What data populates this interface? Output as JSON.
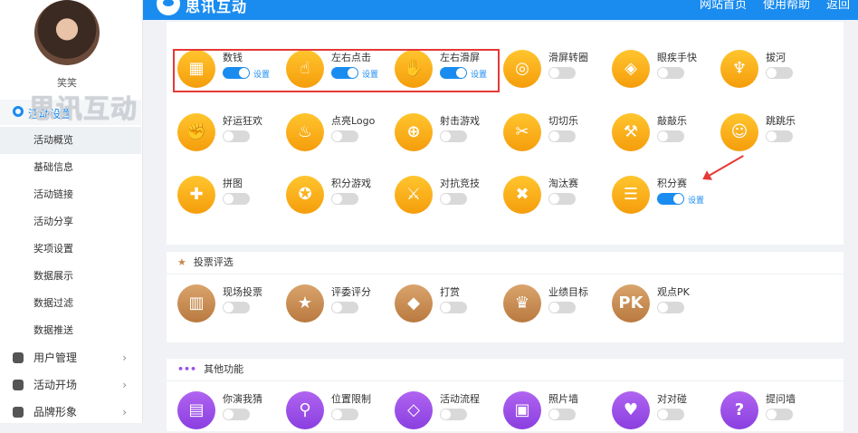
{
  "topbar": {
    "title": "思讯互动",
    "nav": [
      "网站首页",
      "使用帮助",
      "返回"
    ]
  },
  "sidebar": {
    "username": "笑笑",
    "watermark": "思讯互动",
    "active_label": "活动设置",
    "submenu": [
      "活动概览",
      "基础信息",
      "活动链接",
      "活动分享",
      "奖项设置",
      "数据展示",
      "数据过滤",
      "数据推送"
    ],
    "menu": [
      {
        "label": "用户管理",
        "icon": "user-icon"
      },
      {
        "label": "活动开场",
        "icon": "send-icon"
      },
      {
        "label": "品牌形象",
        "icon": "registered-icon"
      }
    ]
  },
  "setting_label": "设置",
  "games_section": {
    "rows": [
      [
        {
          "name": "数钱",
          "glyph": "▦",
          "on": true
        },
        {
          "name": "左右点击",
          "glyph": "☝",
          "on": true
        },
        {
          "name": "左右滑屏",
          "glyph": "✋",
          "on": true
        },
        {
          "name": "滑屏转圈",
          "glyph": "◎",
          "on": false
        },
        {
          "name": "眼疾手快",
          "glyph": "◈",
          "on": false
        },
        {
          "name": "拔河",
          "glyph": "♆",
          "on": false
        }
      ],
      [
        {
          "name": "好运狂欢",
          "glyph": "✊",
          "on": false
        },
        {
          "name": "点亮Logo",
          "glyph": "♨",
          "on": false
        },
        {
          "name": "射击游戏",
          "glyph": "⊕",
          "on": false
        },
        {
          "name": "切切乐",
          "glyph": "✂",
          "on": false
        },
        {
          "name": "敲敲乐",
          "glyph": "⚒",
          "on": false
        },
        {
          "name": "跳跳乐",
          "glyph": "☺",
          "on": false
        }
      ],
      [
        {
          "name": "拼图",
          "glyph": "✚",
          "on": false
        },
        {
          "name": "积分游戏",
          "glyph": "✪",
          "on": false
        },
        {
          "name": "对抗竞技",
          "glyph": "⚔",
          "on": false
        },
        {
          "name": "淘汰赛",
          "glyph": "✖",
          "on": false
        },
        {
          "name": "积分赛",
          "glyph": "☰",
          "on": true
        }
      ]
    ]
  },
  "vote_section": {
    "title": "投票评选",
    "items": [
      {
        "name": "现场投票",
        "glyph": "▥",
        "on": false
      },
      {
        "name": "评委评分",
        "glyph": "★",
        "on": false
      },
      {
        "name": "打赏",
        "glyph": "◆",
        "on": false
      },
      {
        "name": "业绩目标",
        "glyph": "♛",
        "on": false
      },
      {
        "name": "观点PK",
        "glyph": "PK",
        "on": false
      }
    ]
  },
  "other_section": {
    "title": "其他功能",
    "items": [
      {
        "name": "你演我猜",
        "glyph": "▤",
        "on": false
      },
      {
        "name": "位置限制",
        "glyph": "⚲",
        "on": false
      },
      {
        "name": "活动流程",
        "glyph": "◇",
        "on": false
      },
      {
        "name": "照片墙",
        "glyph": "▣",
        "on": false
      },
      {
        "name": "对对碰",
        "glyph": "♥",
        "on": false
      },
      {
        "name": "提问墙",
        "glyph": "?",
        "on": false
      }
    ]
  },
  "colors": {
    "primary": "#1a8cf0",
    "gold": "#f8ae1a",
    "brown": "#c48a50",
    "purple": "#9b4fe8",
    "annotation_red": "#e53935"
  }
}
